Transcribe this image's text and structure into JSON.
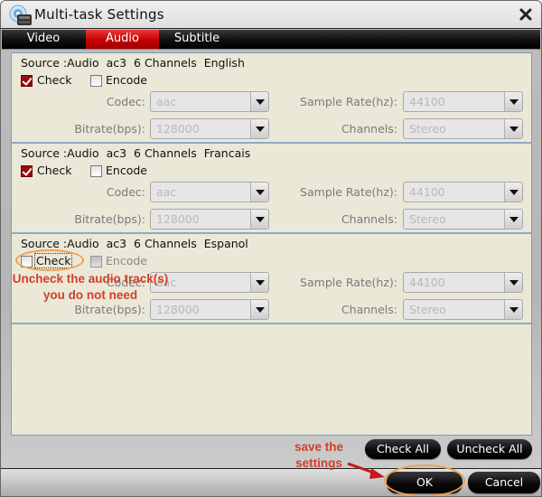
{
  "window": {
    "title": "Multi-task Settings",
    "icons": {
      "app": "disc-film-icon",
      "close": "close-icon"
    }
  },
  "tabs": [
    {
      "label": "Video",
      "active": false
    },
    {
      "label": "Audio",
      "active": true
    },
    {
      "label": "Subtitle",
      "active": false
    }
  ],
  "tracks": [
    {
      "source": "Source :Audio  ac3  6 Channels  English",
      "check": {
        "label": "Check",
        "checked": true
      },
      "encode": {
        "label": "Encode",
        "checked": false,
        "disabled": false
      },
      "codec": {
        "label": "Codec:",
        "value": "aac"
      },
      "sample_rate": {
        "label": "Sample Rate(hz):",
        "value": "44100"
      },
      "bitrate": {
        "label": "Bitrate(bps):",
        "value": "128000"
      },
      "channels": {
        "label": "Channels:",
        "value": "Stereo"
      }
    },
    {
      "source": "Source :Audio  ac3  6 Channels  Francais",
      "check": {
        "label": "Check",
        "checked": true
      },
      "encode": {
        "label": "Encode",
        "checked": false,
        "disabled": false
      },
      "codec": {
        "label": "Codec:",
        "value": "aac"
      },
      "sample_rate": {
        "label": "Sample Rate(hz):",
        "value": "44100"
      },
      "bitrate": {
        "label": "Bitrate(bps):",
        "value": "128000"
      },
      "channels": {
        "label": "Channels:",
        "value": "Stereo"
      }
    },
    {
      "source": "Source :Audio  ac3  6 Channels  Espanol",
      "check": {
        "label": "Check",
        "checked": false
      },
      "encode": {
        "label": "Encode",
        "checked": false,
        "disabled": true
      },
      "codec": {
        "label": "Codec:",
        "value": "aac"
      },
      "sample_rate": {
        "label": "Sample Rate(hz):",
        "value": "44100"
      },
      "bitrate": {
        "label": "Bitrate(bps):",
        "value": "128000"
      },
      "channels": {
        "label": "Channels:",
        "value": "Stereo"
      }
    }
  ],
  "actions": {
    "check_all": "Check All",
    "uncheck_all": "Uncheck All",
    "ok": "OK",
    "cancel": "Cancel"
  },
  "annotations": {
    "uncheck_line1": "Uncheck the audio track(s)",
    "uncheck_line2": "you do not need",
    "save_line1": "save the",
    "save_line2": "settings",
    "color": "#d0402a",
    "highlight_color": "#f0a050"
  },
  "colors": {
    "active_tab": "#c40000",
    "panel_bg": "#ebe8d8",
    "panel_border": "#7f9db9"
  }
}
